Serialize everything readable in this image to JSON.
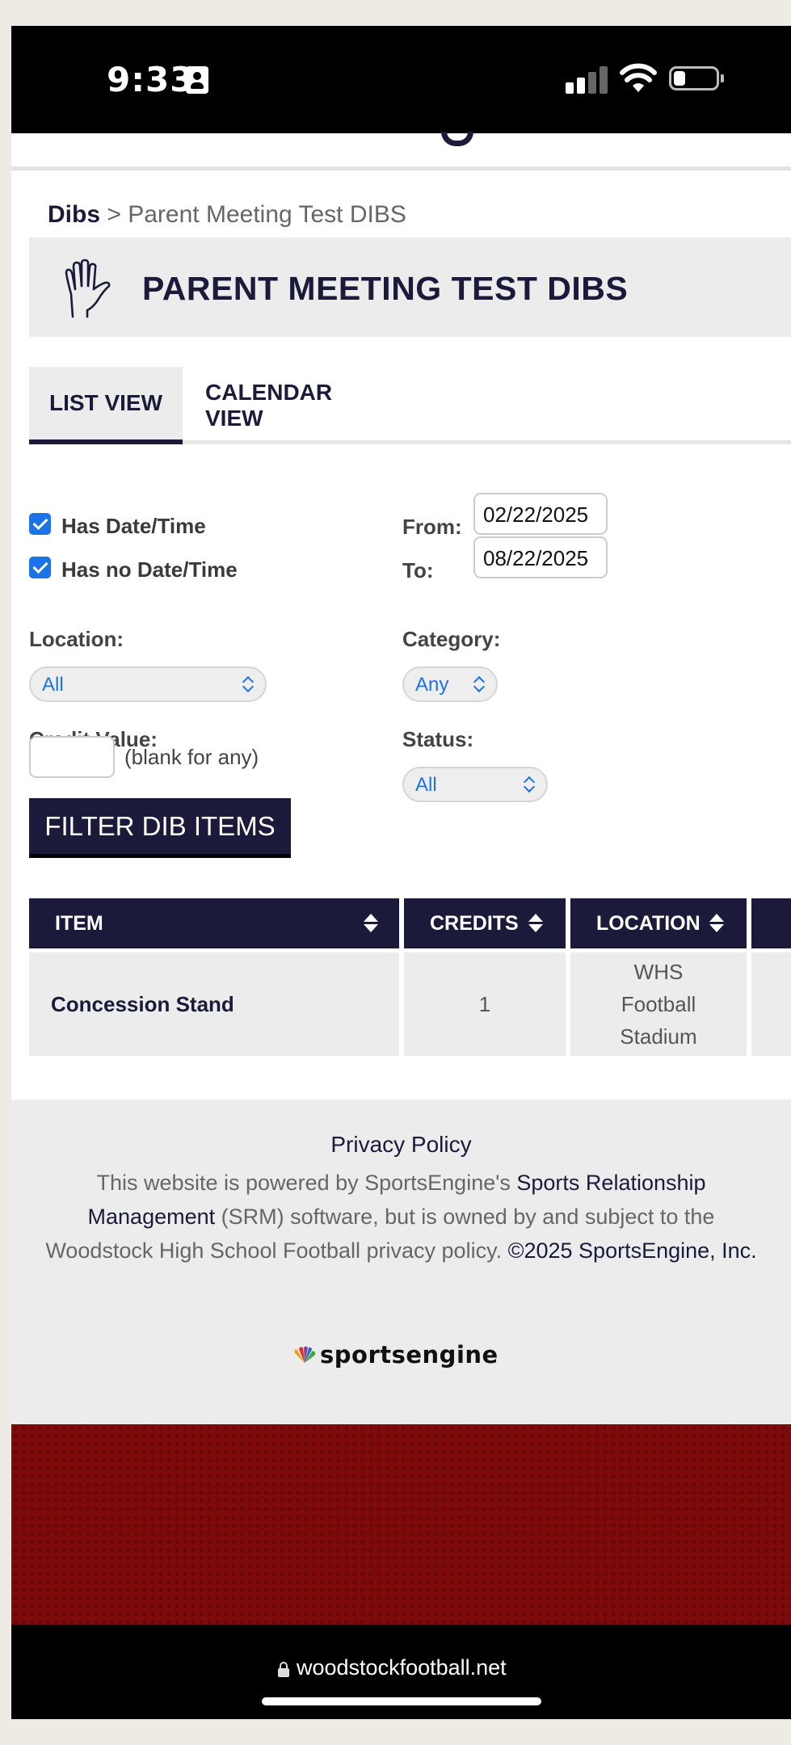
{
  "status_bar": {
    "time": "9:33"
  },
  "breadcrumb": {
    "root": "Dibs",
    "separator": ">",
    "current": "Parent Meeting Test DIBS"
  },
  "page": {
    "title": "PARENT MEETING TEST DIBS"
  },
  "tabs": [
    {
      "label": "LIST VIEW",
      "active": true
    },
    {
      "label": "CALENDAR VIEW",
      "active": false
    }
  ],
  "filters": {
    "has_date_time": {
      "label": "Has Date/Time",
      "checked": true
    },
    "has_no_date_time": {
      "label": "Has no Date/Time",
      "checked": true
    },
    "from": {
      "label": "From:",
      "value": "02/22/2025"
    },
    "to": {
      "label": "To:",
      "value": "08/22/2025"
    },
    "location": {
      "label": "Location:",
      "selected": "All"
    },
    "category": {
      "label": "Category:",
      "selected": "Any"
    },
    "credit_value": {
      "label": "Credit Value:",
      "value": "",
      "hint": "(blank for any)"
    },
    "status": {
      "label": "Status:",
      "selected": "All"
    },
    "submit_label": "FILTER DIB ITEMS"
  },
  "table": {
    "columns": [
      "ITEM",
      "CREDITS",
      "LOCATION"
    ],
    "rows": [
      {
        "item": "Concession Stand",
        "credits": "1",
        "location_lines": [
          "WHS",
          "Football",
          "Stadium"
        ]
      }
    ]
  },
  "footer": {
    "privacy_link": "Privacy Policy",
    "powered_prefix": "This website is powered by SportsEngine's ",
    "srm_link": "Sports Relationship Management",
    "powered_middle": " (SRM) software, but is owned by and subject to the Woodstock High School Football privacy policy. ",
    "copyright": "©2025 SportsEngine, Inc.",
    "logo_text": "sportsengine"
  },
  "url_bar": {
    "domain": "woodstockfootball.net"
  },
  "colors": {
    "navy": "#1c1a3a",
    "checkbox_blue": "#1a73e8",
    "maroon_band": "#7d0b0b"
  }
}
